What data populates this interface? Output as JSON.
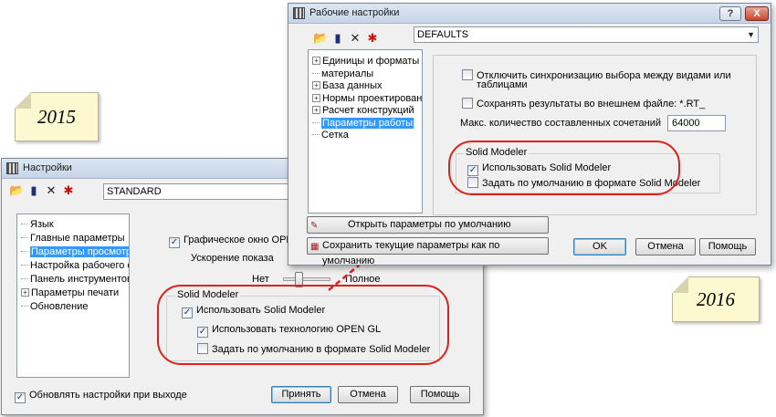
{
  "note_2015": "2015",
  "note_2016": "2016",
  "dlg2015": {
    "title": "Настройки",
    "combo_value": "STANDARD",
    "tree": [
      {
        "label": "Язык",
        "expandable": false,
        "selected": false
      },
      {
        "label": "Главные параметры",
        "expandable": false,
        "selected": false
      },
      {
        "label": "Параметры просмотра",
        "expandable": false,
        "selected": true
      },
      {
        "label": "Настройка рабочего ст",
        "expandable": false,
        "selected": false
      },
      {
        "label": "Панель инструментов и",
        "expandable": false,
        "selected": false
      },
      {
        "label": "Параметры печати",
        "expandable": true,
        "selected": false
      },
      {
        "label": "Обновление",
        "expandable": false,
        "selected": false
      }
    ],
    "opengl_window": "Графическое окно OPEN GL",
    "accel_label": "Ускорение показа",
    "slider_min": "Нет",
    "slider_max": "Полное",
    "group_title": "Solid Modeler",
    "use_solid": "Использовать Solid Modeler",
    "use_opengl": "Использовать технологию OPEN GL",
    "default_solid": "Задать по умолчанию в формате Solid Modeler",
    "update_on_exit": "Обновлять настройки при выходе",
    "accept": "Принять",
    "cancel": "Отмена",
    "help": "Помощь"
  },
  "dlg2016": {
    "title": "Рабочие настройки",
    "help_btn": "?",
    "close_btn": "X",
    "combo_value": "DEFAULTS",
    "tree": [
      {
        "label": "Единицы и форматы",
        "expandable": true,
        "selected": false
      },
      {
        "label": "материалы",
        "expandable": false,
        "selected": false
      },
      {
        "label": "База данных",
        "expandable": true,
        "selected": false
      },
      {
        "label": "Нормы проектирования",
        "expandable": true,
        "selected": false
      },
      {
        "label": "Расчет конструкций",
        "expandable": true,
        "selected": false
      },
      {
        "label": "Параметры работы",
        "expandable": false,
        "selected": true
      },
      {
        "label": "Сетка",
        "expandable": false,
        "selected": false
      }
    ],
    "sync_line1": "Отключить синхронизацию выбора между видами или",
    "sync_line2": "таблицами",
    "save_external": "Сохранять результаты во внешнем файле: *.RT_",
    "max_combos_label": "Макс. количество составленных сочетаний",
    "max_combos_value": "64000",
    "group_title": "Solid Modeler",
    "use_solid": "Использовать Solid Modeler",
    "default_solid": "Задать по умолчанию в формате Solid Modeler",
    "open_defaults": "Открыть параметры по умолчанию",
    "save_defaults": "Сохранить текущие параметры как по умолчанию",
    "ok": "OK",
    "cancel": "Отмена",
    "help": "Помощь"
  }
}
